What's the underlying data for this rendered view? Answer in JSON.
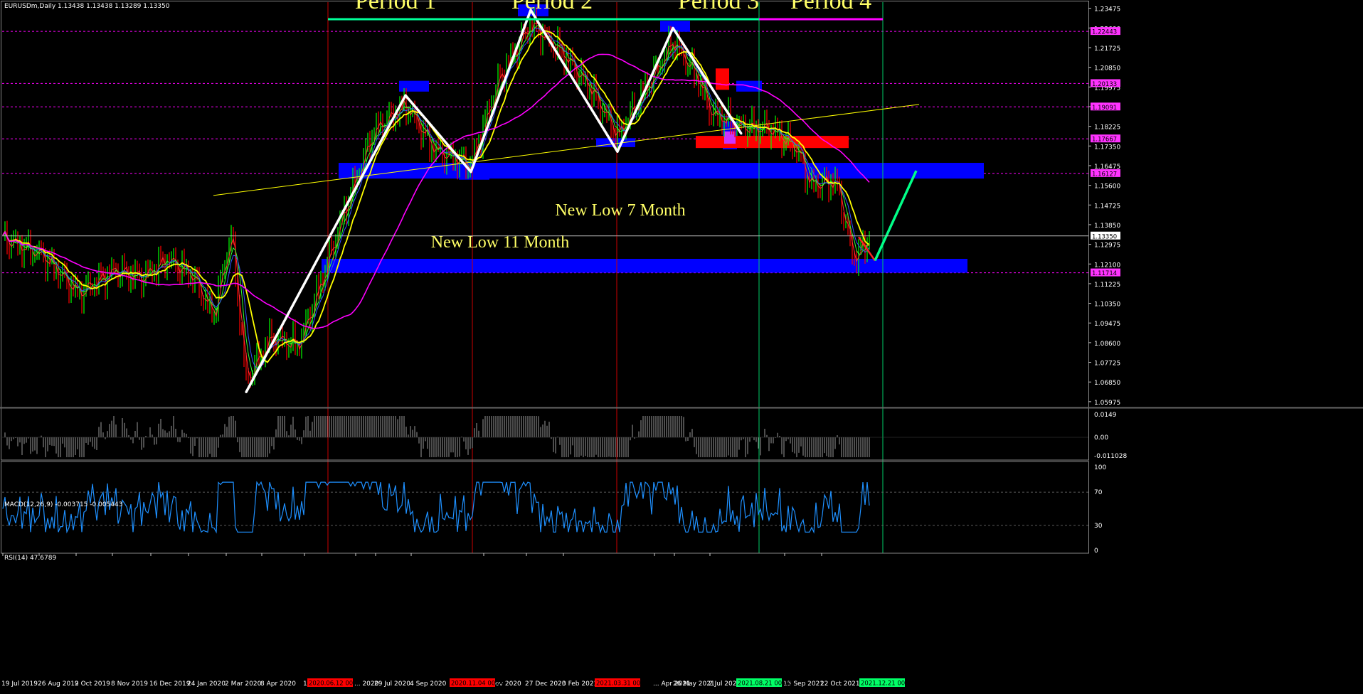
{
  "chart_data": {
    "type": "line",
    "symbol_header": "EURUSDm,Daily  1.13438 1.13438 1.13289 1.13350",
    "current_price": "1.13350",
    "period_labels": [
      "Period 1",
      "Period 2",
      "Period 3",
      "Period 4"
    ],
    "annotations": [
      "New Low 11 Month",
      "New Low 7 Month"
    ],
    "price_axis": {
      "ylim": [
        1.0575,
        1.2375
      ],
      "ticks": [
        "1.23475",
        "1.22600",
        "1.21725",
        "1.20850",
        "1.19975",
        "1.19100",
        "1.18225",
        "1.17350",
        "1.16475",
        "1.15600",
        "1.14725",
        "1.13850",
        "1.12975",
        "1.12100",
        "1.11225",
        "1.10350",
        "1.09475",
        "1.08600",
        "1.07725",
        "1.06850",
        "1.05975"
      ],
      "level_tags": [
        {
          "value": 1.2245,
          "text": "1.22443",
          "color": "#ff33ff"
        },
        {
          "value": 1.2013,
          "text": "1.20133",
          "color": "#ff33ff"
        },
        {
          "value": 1.1909,
          "text": "1.19091",
          "color": "#ff33ff"
        },
        {
          "value": 1.1767,
          "text": "1.17667",
          "color": "#ff33ff"
        },
        {
          "value": 1.1613,
          "text": "1.16127",
          "color": "#ff33ff"
        },
        {
          "value": 1.1335,
          "text": "1.13350",
          "color": "#ffffff"
        },
        {
          "value": 1.1171,
          "text": "1.11714",
          "color": "#ff33ff"
        }
      ]
    },
    "zigzag_pivots": [
      {
        "date": "Mar 2020",
        "y": 1.064
      },
      {
        "date": "Aug 2020",
        "y": 1.196
      },
      {
        "date": "Nov 2020",
        "y": 1.162
      },
      {
        "date": "Jan 2021",
        "y": 1.234
      },
      {
        "date": "Mar 2021",
        "y": 1.171
      },
      {
        "date": "May 2021",
        "y": 1.226
      },
      {
        "date": "Aug 2021",
        "y": 1.179
      }
    ],
    "projection": [
      {
        "date": "Dec 2021",
        "y": 1.1225
      },
      {
        "date": "Jan 2022",
        "y": 1.1625
      }
    ],
    "date_ticks": [
      "19 Jul 2019",
      "26 Aug 2019",
      "2 Oct 2019",
      "8 Nov 2019",
      "16 Dec 2019",
      "24 Jan 2020",
      "2 Mar 2020",
      "8 Apr 2020",
      "15 ...",
      "... 2020",
      "29 Jul 2020",
      "4 Sep 2020",
      "... Nov 2020",
      "27 Dec 2020",
      "3 Feb 2021",
      "... Apr 2021",
      "26 May 2021",
      "2 Jul 2021",
      "15 Sep 2021",
      "22 Oct 2021"
    ],
    "highlighted_dates": [
      {
        "text": "2020.06.12 00:00",
        "color": "#ff0000"
      },
      {
        "text": "2020.11.04 00:00",
        "color": "#ff0000"
      },
      {
        "text": "2021.03.31 00:00",
        "color": "#ff0000"
      },
      {
        "text": "2021.08.21 00:00",
        "color": "#00ff66"
      },
      {
        "text": "2021.12.21 00:00",
        "color": "#00ff66"
      }
    ],
    "macd": {
      "label": "MACD(12,26,9) -0.003715 -0.005443",
      "ticks": [
        "0.0149",
        "0.00",
        "-0.011028"
      ],
      "ylim": [
        -0.011028,
        0.0149
      ]
    },
    "rsi": {
      "label": "RSI(14) 47.6789",
      "ticks": [
        "100",
        "70",
        "30",
        "0"
      ],
      "ylim": [
        0,
        100
      ]
    },
    "colors": {
      "background": "#000000",
      "candle_up": "#00ff00",
      "candle_down": "#ff0000",
      "ma_fast": "#ffff00",
      "ma_slow": "#ff00ff",
      "zigzag": "#ffffff",
      "zone": "#0000ff",
      "red_zone": "#ff0000",
      "rsi_line": "#1e90ff",
      "period_bar_green": "#00ff99",
      "period_bar_magenta": "#ff00ff"
    }
  }
}
